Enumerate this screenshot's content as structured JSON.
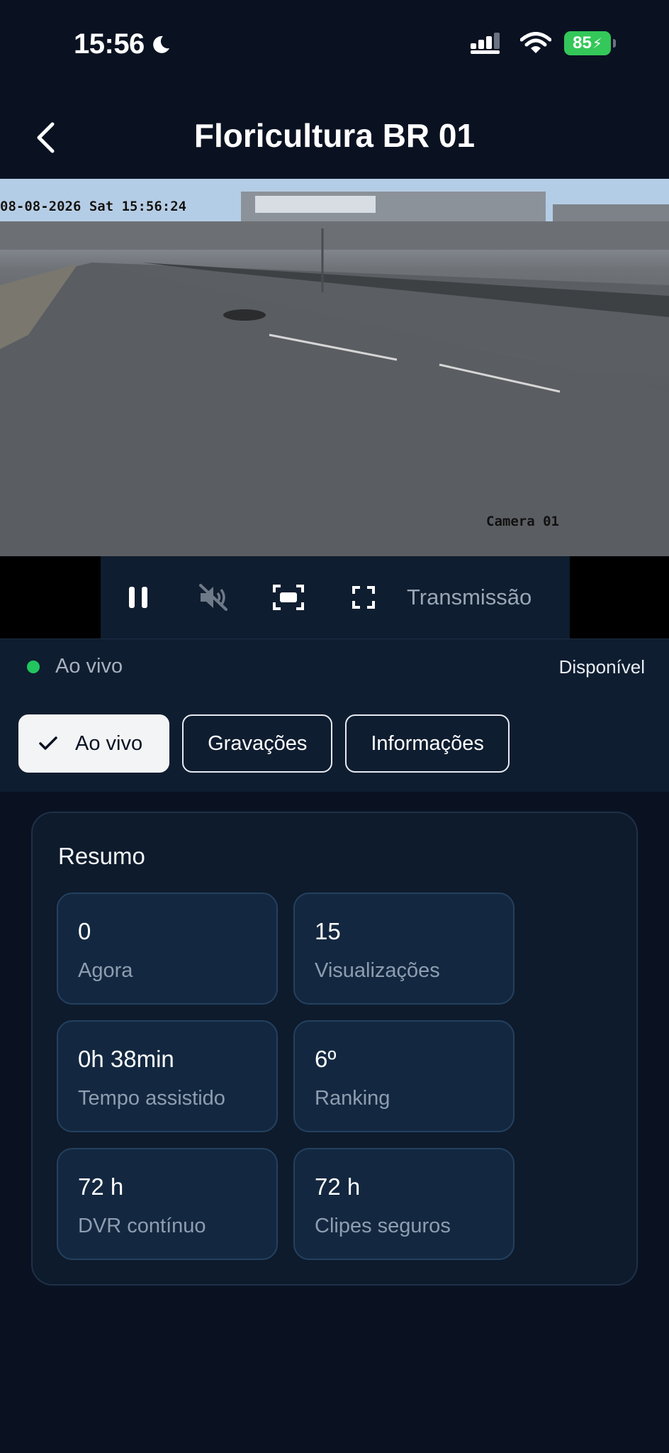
{
  "status_bar": {
    "time": "15:56",
    "battery": "85"
  },
  "header": {
    "title": "Floricultura BR 01"
  },
  "video": {
    "timestamp": "08-08-2026 Sat 15:56:24",
    "camera_label": "Camera 01"
  },
  "controls": {
    "broadcast_label": "Transmissão"
  },
  "stream_status": {
    "live_label": "Ao vivo",
    "availability": "Disponível"
  },
  "tabs": [
    {
      "label": "Ao vivo",
      "active": true
    },
    {
      "label": "Gravações",
      "active": false
    },
    {
      "label": "Informações",
      "active": false
    }
  ],
  "summary": {
    "title": "Resumo",
    "stats": [
      {
        "value": "0",
        "label": "Agora"
      },
      {
        "value": "15",
        "label": "Visualizações"
      },
      {
        "value": "0h 38min",
        "label": "Tempo assistido"
      },
      {
        "value": "6º",
        "label": "Ranking"
      },
      {
        "value": "72 h",
        "label": "DVR contínuo"
      },
      {
        "value": "72 h",
        "label": "Clipes seguros"
      }
    ]
  },
  "colors": {
    "background": "#0a1222",
    "panel": "#0f1d30",
    "live_dot": "#22c55e",
    "battery": "#34c759"
  }
}
